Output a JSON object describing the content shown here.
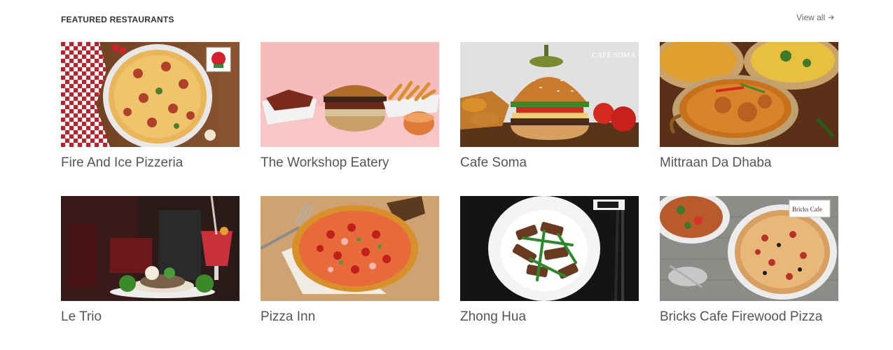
{
  "section": {
    "title": "FEATURED RESTAURANTS",
    "view_all": "View all"
  },
  "restaurants": [
    {
      "name": "Fire And Ice Pizzeria",
      "image": "pepperoni-pizza-on-wooden-table"
    },
    {
      "name": "The Workshop Eatery",
      "image": "burger-and-fries-on-pink-background"
    },
    {
      "name": "Cafe Soma",
      "image": "sesame-burger-with-tomatoes",
      "image_text": "CAFÉ SOMA"
    },
    {
      "name": "Mittraan Da Dhaba",
      "image": "indian-curry-bowls"
    },
    {
      "name": "Le Trio",
      "image": "dinner-plate-with-red-drink"
    },
    {
      "name": "Pizza Inn",
      "image": "pizza-with-fork-on-wood-board"
    },
    {
      "name": "Zhong Hua",
      "image": "stir-fry-on-white-plate-with-chopsticks"
    },
    {
      "name": "Bricks Cafe Firewood Pizza",
      "image": "firewood-pizza-with-side-dishes",
      "image_text": "Bricks Cafe"
    }
  ]
}
